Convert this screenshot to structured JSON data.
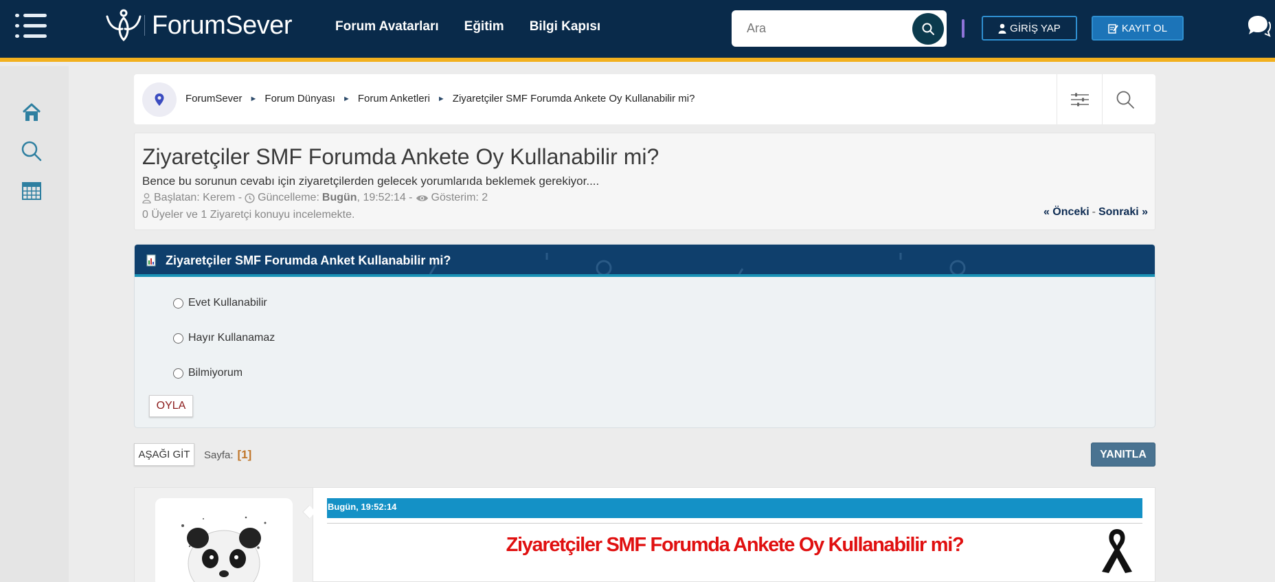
{
  "header": {
    "logo_text": "ForumSever",
    "nav": [
      "Forum Avatarları",
      "Eğitim",
      "Bilgi Kapısı"
    ],
    "search_placeholder": "Ara",
    "login_label": "GİRİŞ YAP",
    "register_label": "KAYIT OL"
  },
  "breadcrumb": [
    "ForumSever",
    "Forum Dünyası",
    "Forum Anketleri",
    "Ziyaretçiler SMF Forumda Ankete Oy Kullanabilir mi?"
  ],
  "topic": {
    "title": "Ziyaretçiler SMF Forumda Ankete Oy Kullanabilir mi?",
    "description": "Bence bu sorunun cevabı için ziyaretçilerden gelecek yorumlarıda beklemek gerekiyor....",
    "started_label": "Başlatan: Kerem -",
    "updated_label": "Güncelleme:",
    "updated_day": "Bugün",
    "updated_time": ", 19:52:14 -",
    "views_label": "Gösterim: 2",
    "viewers": "0 Üyeler ve 1 Ziyaretçi konuyu incelemekte.",
    "prev": "« Önceki",
    "separator": "-",
    "next": "Sonraki »"
  },
  "poll": {
    "title": "Ziyaretçiler SMF Forumda Anket Kullanabilir mi?",
    "options": [
      "Evet Kullanabilir",
      "Hayır Kullanamaz",
      "Bilmiyorum"
    ],
    "vote_label": "OYLA"
  },
  "pagination": {
    "go_down": "AŞAĞI GİT",
    "pages_label": "Sayfa:",
    "current_page": "[1]",
    "reply_label": "YANITLA"
  },
  "post": {
    "date": "Bugün, 19:52:14",
    "title": "Ziyaretçiler SMF Forumda Ankete Oy Kullanabilir mi?"
  },
  "colors": {
    "header_bg": "#092a4a",
    "accent_stripe": "#f2b01e",
    "poll_header": "#0f3f6c",
    "post_datebar": "#1491c6",
    "post_title": "#e01010"
  },
  "icons": {
    "menu": "hamburger-icon",
    "search": "search-icon",
    "user": "user-icon",
    "register": "edit-icon",
    "chat": "chat-icon",
    "home": "home-icon",
    "calendar": "calendar-icon",
    "location": "map-pin-icon",
    "filter": "sliders-icon",
    "poll": "poll-icon",
    "ribbon": "mourning-ribbon-icon"
  }
}
